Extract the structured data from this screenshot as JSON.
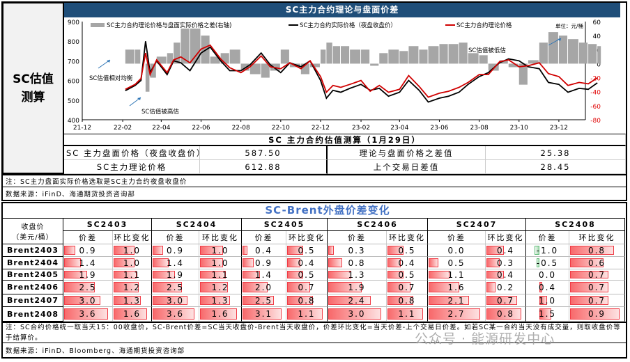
{
  "left_label": "SC估值测算",
  "header_title": "SC主力合约理论与盘面价差",
  "chart_data": {
    "type": "line+bar",
    "title": "SC主力合约理论与盘面价差",
    "unit_label": "单位：元/桶",
    "legend": [
      "SC主力合约理论价格与盘面实际价格之差(右轴)",
      "SC主力合约实际价格（夜盘收盘价）",
      "SC主力合约理论价格"
    ],
    "x_ticks": [
      "21-12",
      "22-02",
      "22-04",
      "22-06",
      "22-08",
      "22-10",
      "22-12",
      "23-02",
      "23-04",
      "23-06",
      "23-08",
      "23-10",
      "23-12"
    ],
    "y_left_ticks": [
      400,
      500,
      600,
      700,
      800,
      900
    ],
    "y_right_ticks": [
      -80,
      -60,
      -40,
      -20,
      0,
      20,
      40,
      60
    ],
    "ylim_left": [
      400,
      900
    ],
    "ylim_right": [
      -80,
      60
    ],
    "annotations": [
      "SC估值相对均衡",
      "SC估值被高估",
      "SC估值被低估"
    ],
    "dates": [
      "2022-02-05",
      "2022-02-20",
      "2022-03-01",
      "2022-03-08",
      "2022-03-15",
      "2022-03-25",
      "2022-04-10",
      "2022-04-20",
      "2022-05-01",
      "2022-05-15",
      "2022-06-01",
      "2022-06-15",
      "2022-07-01",
      "2022-07-15",
      "2022-08-01",
      "2022-08-15",
      "2022-09-01",
      "2022-09-15",
      "2022-10-01",
      "2022-10-15",
      "2022-11-01",
      "2022-11-15",
      "2022-12-01",
      "2022-12-10",
      "2022-12-20",
      "2023-01-01",
      "2023-01-15",
      "2023-02-01",
      "2023-02-15",
      "2023-03-01",
      "2023-03-15",
      "2023-04-01",
      "2023-04-15",
      "2023-05-01",
      "2023-05-15",
      "2023-06-01",
      "2023-06-15",
      "2023-07-01",
      "2023-07-15",
      "2023-08-01",
      "2023-08-15",
      "2023-09-01",
      "2023-09-15",
      "2023-10-01",
      "2023-10-15",
      "2023-11-01",
      "2023-11-15",
      "2023-12-01",
      "2023-12-15",
      "2024-01-01",
      "2024-01-15",
      "2024-01-29"
    ],
    "series": [
      {
        "name": "SC主力合约实际价格（夜盘收盘价）",
        "axis": "left",
        "color": "#000000",
        "values": [
          548,
          575,
          600,
          800,
          640,
          700,
          630,
          700,
          690,
          650,
          740,
          770,
          700,
          650,
          650,
          680,
          740,
          680,
          640,
          690,
          670,
          700,
          600,
          510,
          550,
          540,
          560,
          580,
          550,
          560,
          520,
          540,
          600,
          550,
          490,
          510,
          520,
          540,
          580,
          620,
          640,
          690,
          710,
          700,
          670,
          660,
          590,
          580,
          540,
          560,
          555,
          588
        ]
      },
      {
        "name": "SC主力合约理论价格",
        "axis": "left",
        "color": "#d00000",
        "values": [
          555,
          580,
          610,
          740,
          630,
          705,
          640,
          705,
          720,
          690,
          760,
          780,
          710,
          665,
          640,
          670,
          725,
          670,
          660,
          690,
          660,
          700,
          620,
          540,
          575,
          565,
          580,
          600,
          545,
          575,
          540,
          555,
          625,
          570,
          515,
          535,
          545,
          565,
          590,
          630,
          630,
          695,
          705,
          670,
          675,
          690,
          635,
          620,
          575,
          590,
          583,
          613
        ]
      },
      {
        "name": "SC主力合约理论价格与盘面实际价格之差(右轴)",
        "axis": "right",
        "color": "#a6a6a6",
        "values": [
          20,
          20,
          0,
          -40,
          -20,
          10,
          15,
          30,
          50,
          50,
          40,
          10,
          15,
          20,
          -10,
          -15,
          -20,
          -10,
          20,
          -5,
          -15,
          -5,
          20,
          30,
          25,
          25,
          20,
          20,
          -3,
          15,
          20,
          18,
          25,
          20,
          25,
          28,
          28,
          30,
          15,
          12,
          -10,
          5,
          -5,
          -30,
          5,
          30,
          45,
          40,
          35,
          30,
          28,
          25
        ]
      }
    ]
  },
  "valuation": {
    "title": "SC 主力合约估值测算（1月29日）",
    "r1_label": "SC 主力盘面价格（夜盘收盘价）",
    "r1_value": "587.50",
    "r1_label2": "理论与盘面价格之差值",
    "r1_value2": "25.38",
    "r2_label": "SC主力理论价格",
    "r2_value": "612.88",
    "r2_label2": "上个交易日差值",
    "r2_value2": "28.45"
  },
  "note1": "注：SC主力盘面实际价格选取是SC主力合约夜盘收盘价",
  "source1": "数据来源：iFinD、海通期货投资咨询部",
  "spread_table": {
    "title": "SC-Brent外盘价差变化",
    "corner_label": "收盘价",
    "corner_unit": "（美元/桶）",
    "sub_headers": [
      "价差",
      "环比变化"
    ],
    "rows": [
      "Brent2403",
      "Brent2404",
      "Brent2405",
      "Brent2406",
      "Brent2407",
      "Brent2408"
    ],
    "contracts": [
      {
        "name": "SC2403",
        "diff": [
          "0.9",
          "1.4",
          "1.9",
          "2.5",
          "3.0",
          "3.6"
        ],
        "change": [
          "1.0",
          "1.0",
          "1.1",
          "1.2",
          "1.3",
          "1.6"
        ]
      },
      {
        "name": "SC2404",
        "diff": [
          "0.9",
          "1.4",
          "1.9",
          "2.5",
          "3.0",
          "3.6"
        ],
        "change": [
          "1.0",
          "1.0",
          "1.1",
          "1.2",
          "1.3",
          "1.6"
        ]
      },
      {
        "name": "SC2405",
        "diff": [
          "0.4",
          "0.9",
          "1.4",
          "2.0",
          "2.5",
          "3.1"
        ],
        "change": [
          "0.5",
          "0.4",
          "0.5",
          "0.7",
          "0.8",
          "1.1"
        ]
      },
      {
        "name": "SC2406",
        "diff": [
          "0.3",
          "0.8",
          "1.3",
          "1.9",
          "2.4",
          "3.0"
        ],
        "change": [
          "0.5",
          "0.4",
          "0.5",
          "0.7",
          "0.8",
          "1.1"
        ]
      },
      {
        "name": "SC2407",
        "diff": [
          "0.0",
          "0.5",
          "1.1",
          "1.6",
          "2.1",
          "2.7"
        ],
        "change": [
          "0.4",
          "0.3",
          "0.4",
          "0.2",
          "0.7",
          "0.8"
        ]
      },
      {
        "name": "SC2408",
        "diff": [
          "-1.0",
          "-0.5",
          "0.0",
          "0.4",
          "1.0",
          "1.5"
        ],
        "change": [
          "0.8",
          "0.6",
          "0.7",
          "0.7",
          "0.7",
          "0.9"
        ]
      }
    ],
    "bar_colors": {
      "positive": "#f8696b",
      "negative": "#63be7b"
    }
  },
  "note2": "注：SC合约价格统一取当天15：00收盘价，SC-Brent价差=SC当天收盘价-Brent当天收盘价，价差环比变化=当天价差-上个交易日价差。如若SC某一合约当天没有成交量，则取收盘价等于结算价。",
  "source2": "数据来源：iFinD、Bloomberg、海通期货投资咨询部",
  "watermark": "公众号 · 能源研发中心"
}
